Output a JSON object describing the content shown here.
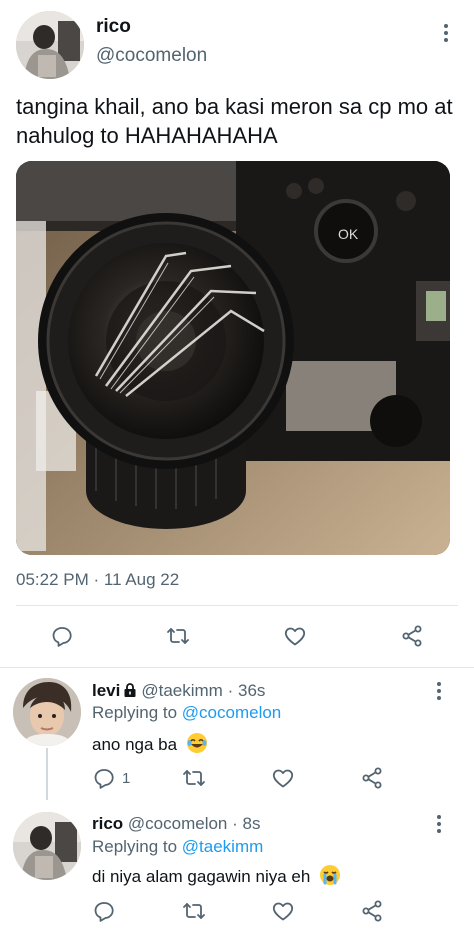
{
  "main_tweet": {
    "author_name": "rico",
    "author_handle": "@cocomelon",
    "text": "tangina khail, ano ba kasi meron sa cp mo at nahulog to HAHAHAHAHA",
    "timestamp": "05:22 PM · 11 Aug 22",
    "photo_icon": "broken-camera-lens-photo"
  },
  "replies": [
    {
      "name": "levi",
      "handle": "@taekimm",
      "separator": "·",
      "time": "36s",
      "replying_prefix": "Replying to",
      "replying_to": "@cocomelon",
      "text": "ano nga ba",
      "emoji_icon": "tears-of-joy-emoji",
      "reply_count": "1",
      "protected_icon": "lock-icon"
    },
    {
      "name": "rico",
      "handle": "@cocomelon",
      "separator": "·",
      "time": "8s",
      "replying_prefix": "Replying to",
      "replying_to": "@taekimm",
      "text": "di niya alam gagawin niya eh",
      "emoji_icon": "loudly-crying-emoji",
      "reply_count": ""
    }
  ],
  "colors": {
    "text_primary": "#0f1419",
    "text_secondary": "#536471",
    "accent": "#1d9bf0",
    "divider": "#e1e6ea"
  }
}
